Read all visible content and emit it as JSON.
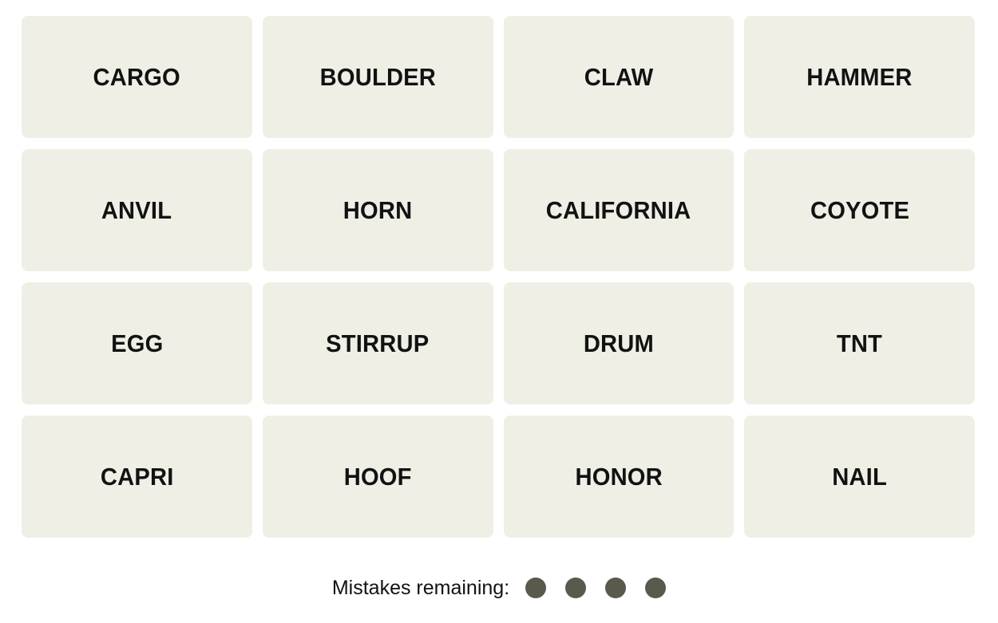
{
  "app": {
    "name": "Connections",
    "background_color": "#FFFFFF"
  },
  "board": {
    "rows": 4,
    "columns": 4,
    "tile_color": "#EFEFE6",
    "tile_text_color": "#121212",
    "tiles": [
      {
        "word": "CARGO",
        "row": 1,
        "col": 1,
        "selected": false
      },
      {
        "word": "BOULDER",
        "row": 1,
        "col": 2,
        "selected": false
      },
      {
        "word": "CLAW",
        "row": 1,
        "col": 3,
        "selected": false
      },
      {
        "word": "HAMMER",
        "row": 1,
        "col": 4,
        "selected": false
      },
      {
        "word": "ANVIL",
        "row": 2,
        "col": 1,
        "selected": false
      },
      {
        "word": "HORN",
        "row": 2,
        "col": 2,
        "selected": false
      },
      {
        "word": "CALIFORNIA",
        "row": 2,
        "col": 3,
        "selected": false
      },
      {
        "word": "COYOTE",
        "row": 2,
        "col": 4,
        "selected": false
      },
      {
        "word": "EGG",
        "row": 3,
        "col": 1,
        "selected": false
      },
      {
        "word": "STIRRUP",
        "row": 3,
        "col": 2,
        "selected": false
      },
      {
        "word": "DRUM",
        "row": 3,
        "col": 3,
        "selected": false
      },
      {
        "word": "TNT",
        "row": 3,
        "col": 4,
        "selected": false
      },
      {
        "word": "CAPRI",
        "row": 4,
        "col": 1,
        "selected": false
      },
      {
        "word": "HOOF",
        "row": 4,
        "col": 2,
        "selected": false
      },
      {
        "word": "HONOR",
        "row": 4,
        "col": 3,
        "selected": false
      },
      {
        "word": "NAIL",
        "row": 4,
        "col": 4,
        "selected": false
      }
    ]
  },
  "mistakes": {
    "label": "Mistakes remaining:",
    "remaining": 4,
    "dot_color": "#5A594E",
    "dots": [
      {
        "filled": true
      },
      {
        "filled": true
      },
      {
        "filled": true
      },
      {
        "filled": true
      }
    ]
  }
}
